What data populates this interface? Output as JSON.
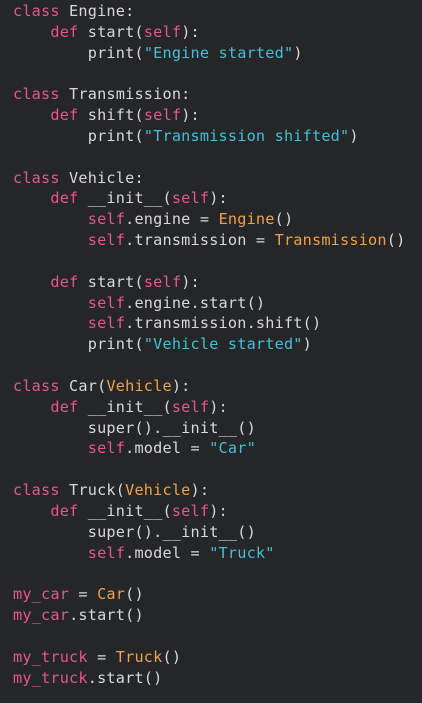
{
  "colors": {
    "background": "#252627",
    "keyword": "#e6568f",
    "string": "#45bfd8",
    "class_ref": "#f0a24a",
    "plain": "#d8d8d8"
  },
  "code": {
    "lines": [
      [
        {
          "t": "class",
          "k": "kw"
        },
        {
          "t": " Engine:",
          "k": "plain"
        }
      ],
      [
        {
          "t": "    ",
          "k": "plain"
        },
        {
          "t": "def",
          "k": "kw"
        },
        {
          "t": " start(",
          "k": "plain"
        },
        {
          "t": "self",
          "k": "self"
        },
        {
          "t": "):",
          "k": "plain"
        }
      ],
      [
        {
          "t": "        print(",
          "k": "plain"
        },
        {
          "t": "\"Engine started\"",
          "k": "str"
        },
        {
          "t": ")",
          "k": "plain"
        }
      ],
      [],
      [
        {
          "t": "class",
          "k": "kw"
        },
        {
          "t": " Transmission:",
          "k": "plain"
        }
      ],
      [
        {
          "t": "    ",
          "k": "plain"
        },
        {
          "t": "def",
          "k": "kw"
        },
        {
          "t": " shift(",
          "k": "plain"
        },
        {
          "t": "self",
          "k": "self"
        },
        {
          "t": "):",
          "k": "plain"
        }
      ],
      [
        {
          "t": "        print(",
          "k": "plain"
        },
        {
          "t": "\"Transmission shifted\"",
          "k": "str"
        },
        {
          "t": ")",
          "k": "plain"
        }
      ],
      [],
      [
        {
          "t": "class",
          "k": "kw"
        },
        {
          "t": " Vehicle:",
          "k": "plain"
        }
      ],
      [
        {
          "t": "    ",
          "k": "plain"
        },
        {
          "t": "def",
          "k": "kw"
        },
        {
          "t": " __init__(",
          "k": "plain"
        },
        {
          "t": "self",
          "k": "self"
        },
        {
          "t": "):",
          "k": "plain"
        }
      ],
      [
        {
          "t": "        ",
          "k": "plain"
        },
        {
          "t": "self",
          "k": "self"
        },
        {
          "t": ".engine = ",
          "k": "plain"
        },
        {
          "t": "Engine",
          "k": "cls"
        },
        {
          "t": "()",
          "k": "plain"
        }
      ],
      [
        {
          "t": "        ",
          "k": "plain"
        },
        {
          "t": "self",
          "k": "self"
        },
        {
          "t": ".transmission = ",
          "k": "plain"
        },
        {
          "t": "Transmission",
          "k": "cls"
        },
        {
          "t": "()",
          "k": "plain"
        }
      ],
      [],
      [
        {
          "t": "    ",
          "k": "plain"
        },
        {
          "t": "def",
          "k": "kw"
        },
        {
          "t": " start(",
          "k": "plain"
        },
        {
          "t": "self",
          "k": "self"
        },
        {
          "t": "):",
          "k": "plain"
        }
      ],
      [
        {
          "t": "        ",
          "k": "plain"
        },
        {
          "t": "self",
          "k": "self"
        },
        {
          "t": ".engine.start()",
          "k": "plain"
        }
      ],
      [
        {
          "t": "        ",
          "k": "plain"
        },
        {
          "t": "self",
          "k": "self"
        },
        {
          "t": ".transmission.shift()",
          "k": "plain"
        }
      ],
      [
        {
          "t": "        print(",
          "k": "plain"
        },
        {
          "t": "\"Vehicle started\"",
          "k": "str"
        },
        {
          "t": ")",
          "k": "plain"
        }
      ],
      [],
      [
        {
          "t": "class",
          "k": "kw"
        },
        {
          "t": " Car(",
          "k": "plain"
        },
        {
          "t": "Vehicle",
          "k": "cls"
        },
        {
          "t": "):",
          "k": "plain"
        }
      ],
      [
        {
          "t": "    ",
          "k": "plain"
        },
        {
          "t": "def",
          "k": "kw"
        },
        {
          "t": " __init__(",
          "k": "plain"
        },
        {
          "t": "self",
          "k": "self"
        },
        {
          "t": "):",
          "k": "plain"
        }
      ],
      [
        {
          "t": "        super().__init__()",
          "k": "plain"
        }
      ],
      [
        {
          "t": "        ",
          "k": "plain"
        },
        {
          "t": "self",
          "k": "self"
        },
        {
          "t": ".model = ",
          "k": "plain"
        },
        {
          "t": "\"Car\"",
          "k": "str"
        }
      ],
      [],
      [
        {
          "t": "class",
          "k": "kw"
        },
        {
          "t": " Truck(",
          "k": "plain"
        },
        {
          "t": "Vehicle",
          "k": "cls"
        },
        {
          "t": "):",
          "k": "plain"
        }
      ],
      [
        {
          "t": "    ",
          "k": "plain"
        },
        {
          "t": "def",
          "k": "kw"
        },
        {
          "t": " __init__(",
          "k": "plain"
        },
        {
          "t": "self",
          "k": "self"
        },
        {
          "t": "):",
          "k": "plain"
        }
      ],
      [
        {
          "t": "        super().__init__()",
          "k": "plain"
        }
      ],
      [
        {
          "t": "        ",
          "k": "plain"
        },
        {
          "t": "self",
          "k": "self"
        },
        {
          "t": ".model = ",
          "k": "plain"
        },
        {
          "t": "\"Truck\"",
          "k": "str"
        }
      ],
      [],
      [
        {
          "t": "my_car",
          "k": "var"
        },
        {
          "t": " = ",
          "k": "plain"
        },
        {
          "t": "Car",
          "k": "cls"
        },
        {
          "t": "()",
          "k": "plain"
        }
      ],
      [
        {
          "t": "my_car",
          "k": "var"
        },
        {
          "t": ".start()",
          "k": "plain"
        }
      ],
      [],
      [
        {
          "t": "my_truck",
          "k": "var"
        },
        {
          "t": " = ",
          "k": "plain"
        },
        {
          "t": "Truck",
          "k": "cls"
        },
        {
          "t": "()",
          "k": "plain"
        }
      ],
      [
        {
          "t": "my_truck",
          "k": "var"
        },
        {
          "t": ".start()",
          "k": "plain"
        }
      ]
    ]
  }
}
